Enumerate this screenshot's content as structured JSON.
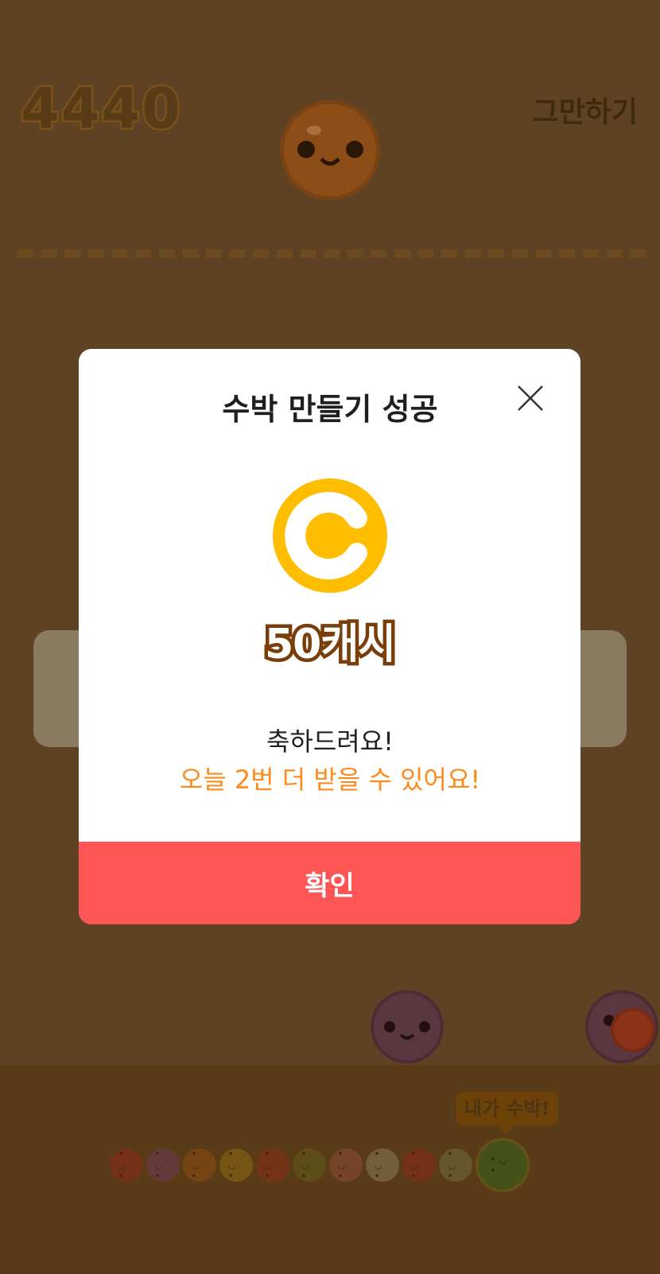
{
  "game": {
    "score": "4440",
    "quit_label": "그만하기",
    "tooltip_label": "내가 수박!",
    "fruit_chain": [
      {
        "name": "cherry",
        "color": "#8a2a1a"
      },
      {
        "name": "grape",
        "color": "#6b3a55"
      },
      {
        "name": "tangerine",
        "color": "#8e4d10"
      },
      {
        "name": "lemon",
        "color": "#8e6a10"
      },
      {
        "name": "tomato",
        "color": "#8a2e12"
      },
      {
        "name": "kiwi",
        "color": "#5e5a1a"
      },
      {
        "name": "peach",
        "color": "#8a4a36"
      },
      {
        "name": "pear",
        "color": "#8a7a5a"
      },
      {
        "name": "apple",
        "color": "#8a2a16"
      },
      {
        "name": "melon",
        "color": "#6e6e3a"
      },
      {
        "name": "watermelon",
        "color": "#3d5a1a"
      }
    ]
  },
  "modal": {
    "title": "수박 만들기 성공",
    "reward": "50캐시",
    "congrats": "축하드려요!",
    "remaining": "오늘 2번 더 받을 수 있어요!",
    "confirm_label": "확인"
  },
  "colors": {
    "confirm": "#ff5555",
    "highlight": "#ff8a1c",
    "coin": "#ffbd00",
    "overlay": "#5e4223"
  }
}
